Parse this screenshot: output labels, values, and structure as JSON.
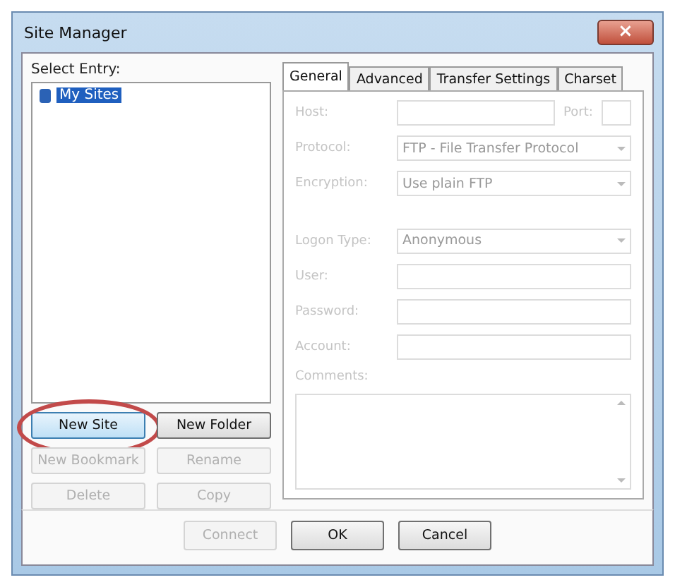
{
  "window": {
    "title": "Site Manager",
    "close": "×"
  },
  "entry_label": "Select Entry:",
  "tree": [
    {
      "label": "My Sites",
      "selected": true
    }
  ],
  "left_buttons": [
    {
      "label": "New Site",
      "disabled": false,
      "circled": true
    },
    {
      "label": "New Folder",
      "disabled": false,
      "circled": false
    },
    {
      "label": "New Bookmark",
      "disabled": true,
      "circled": false
    },
    {
      "label": "Rename",
      "disabled": true,
      "circled": false
    },
    {
      "label": "Delete",
      "disabled": true,
      "circled": false
    },
    {
      "label": "Copy",
      "disabled": true,
      "circled": false
    }
  ],
  "tabs": [
    {
      "label": "General",
      "selected": true
    },
    {
      "label": "Advanced",
      "selected": false
    },
    {
      "label": "Transfer Settings",
      "selected": false
    },
    {
      "label": "Charset",
      "selected": false
    }
  ],
  "general": {
    "disabled": true,
    "host": {
      "label": "Host:",
      "port_label": "Port:"
    },
    "rows": [
      {
        "kind": "select",
        "label": "Protocol:",
        "value": "FTP - File Transfer Protocol"
      },
      {
        "kind": "select",
        "label": "Encryption:",
        "value": "Use plain FTP"
      },
      {
        "kind": "gap"
      },
      {
        "kind": "select",
        "label": "Logon Type:",
        "value": "Anonymous"
      },
      {
        "kind": "input",
        "label": "User:"
      },
      {
        "kind": "input",
        "label": "Password:"
      },
      {
        "kind": "input",
        "label": "Account:"
      }
    ],
    "comments_label": "Comments:"
  },
  "bottom_buttons": [
    {
      "label": "Connect",
      "disabled": true
    },
    {
      "label": "OK",
      "disabled": false
    },
    {
      "label": "Cancel",
      "disabled": false
    }
  ]
}
